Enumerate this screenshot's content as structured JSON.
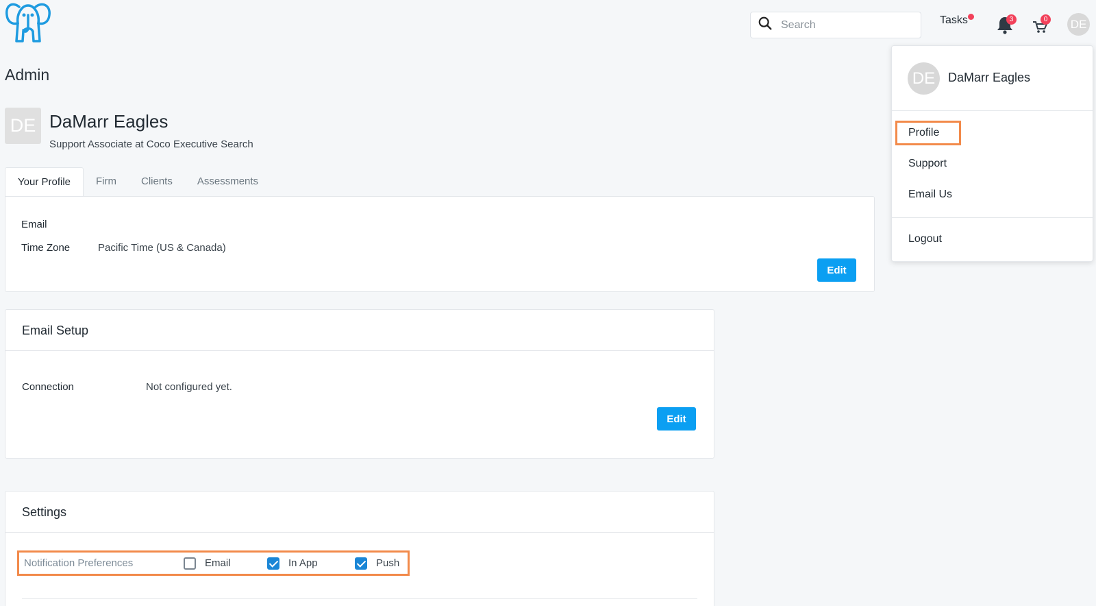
{
  "header": {
    "logo_icon": "elephant-logo-icon",
    "search": {
      "placeholder": "Search",
      "value": ""
    },
    "tasks_label": "Tasks",
    "notifications_count": "3",
    "cart_count": "0",
    "avatar_initials": "DE"
  },
  "page": {
    "title": "Admin"
  },
  "profile": {
    "initials": "DE",
    "name": "DaMarr Eagles",
    "subtitle": "Support Associate at Coco Executive Search"
  },
  "tabs": [
    {
      "label": "Your Profile",
      "active": true
    },
    {
      "label": "Firm"
    },
    {
      "label": "Clients"
    },
    {
      "label": "Assessments"
    }
  ],
  "profile_card": {
    "email_label": "Email",
    "email_value": "",
    "timezone_label": "Time Zone",
    "timezone_value": "Pacific Time (US & Canada)",
    "edit_label": "Edit"
  },
  "email_setup": {
    "title": "Email Setup",
    "connection_label": "Connection",
    "connection_value": "Not configured yet.",
    "edit_label": "Edit"
  },
  "settings": {
    "title": "Settings",
    "notification_label": "Notification Preferences",
    "options": [
      {
        "label": "Email",
        "checked": false
      },
      {
        "label": "In App",
        "checked": true
      },
      {
        "label": "Push",
        "checked": true
      }
    ]
  },
  "user_menu": {
    "initials": "DE",
    "name": "DaMarr Eagles",
    "items": [
      "Profile",
      "Support",
      "Email Us",
      "Logout"
    ]
  },
  "colors": {
    "accent": "#0b9ff2",
    "badge": "#f2415a",
    "highlight": "#f28a4a",
    "checkbox": "#1a86d6"
  }
}
